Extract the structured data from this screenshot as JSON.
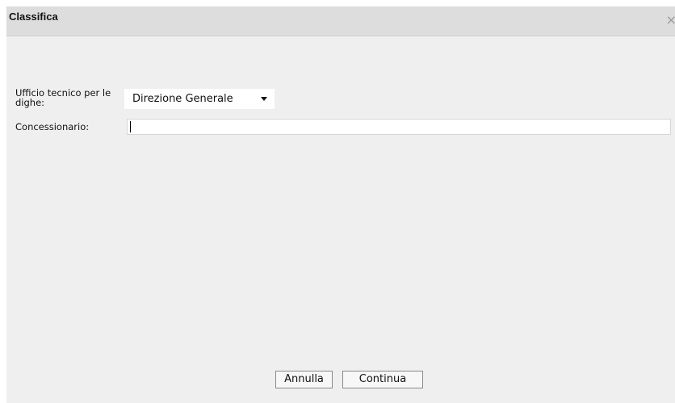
{
  "dialog": {
    "title": "Classifica",
    "close_icon": "close-icon",
    "close_glyph": "×"
  },
  "form": {
    "ufficio_label": "Ufficio tecnico per le dighe:",
    "ufficio_selected": "Direzione Generale",
    "concessionario_label": "Concessionario:",
    "concessionario_value": ""
  },
  "buttons": {
    "annulla_label": "Annulla",
    "continua_label": "Continua"
  },
  "colors": {
    "dialog_bg": "#efefef",
    "titlebar_bg": "#dddddd"
  }
}
